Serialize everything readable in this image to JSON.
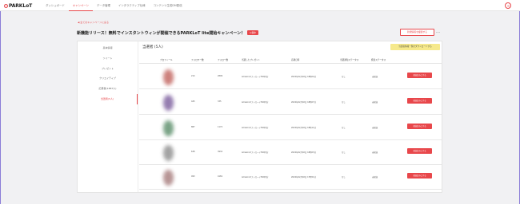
{
  "topbar": {
    "logo_text": "PARKLoT",
    "nav": [
      "ダッシュボード",
      "キャンペーン",
      "データ管理",
      "インタラクティブ仕様",
      "コンテンツ生成DM配信"
    ],
    "active_nav": "キャンペーン"
  },
  "back_link": "◀ 全てのキャンペーンに戻る",
  "page_title": "新機能リリース！無料でインスタントウィンが開催できるPARKLoT lite開始キャンペーン！",
  "status_badge": "公開中",
  "copy_button": "新規情報を複製する",
  "sidebar": {
    "items": [
      "基本情報",
      "ツイート",
      "プレゼント",
      "クリエイティブ",
      "応募者(1887人)",
      "当選者(5人)"
    ],
    "active": "当選者(5人)"
  },
  "winners": {
    "title": "当選者 (5人)",
    "download_label": "当選者情報一覧をダウンロードする",
    "columns": [
      "プロフィール",
      "フォロワー数",
      "フォロー数",
      "当選したプレゼント",
      "応募日時",
      "当選通知ステータス",
      "発送ステータス"
    ],
    "rows": [
      {
        "followers": "214",
        "following": "2809",
        "present": "Amazonギフトカード500円分",
        "date": "2022年02月02日 18時04分",
        "notify": "なし",
        "shipping": "未発送",
        "action": "発送済みにする",
        "avatar_color": "#c8746f"
      },
      {
        "followers": "445",
        "following": "335",
        "present": "Amazonギフトカード500円分",
        "date": "2022年02月02日 18時07分",
        "notify": "なし",
        "shipping": "未発送",
        "action": "発送済みにする",
        "avatar_color": "#8a6fa8"
      },
      {
        "followers": "887",
        "following": "1172",
        "present": "Amazonギフトカード500円分",
        "date": "2022年02月02日 18時11分",
        "notify": "なし",
        "shipping": "未発送",
        "action": "発送済みにする",
        "avatar_color": "#6c9a7a"
      },
      {
        "followers": "638",
        "following": "3932",
        "present": "Amazonギフトカード500円分",
        "date": "2022年02月02日 18時03分",
        "notify": "なし",
        "shipping": "未発送",
        "action": "発送済みにする",
        "avatar_color": "#9a9a9a"
      },
      {
        "followers": "493",
        "following": "4181",
        "present": "Amazonギフトカード500円分",
        "date": "2022年02月02日 17時51分",
        "notify": "なし",
        "shipping": "未発送",
        "action": "発送済みにする",
        "avatar_color": "#b08a8a"
      }
    ]
  },
  "colors": {
    "accent": "#e8474b",
    "download_bg": "#f6e98b"
  }
}
